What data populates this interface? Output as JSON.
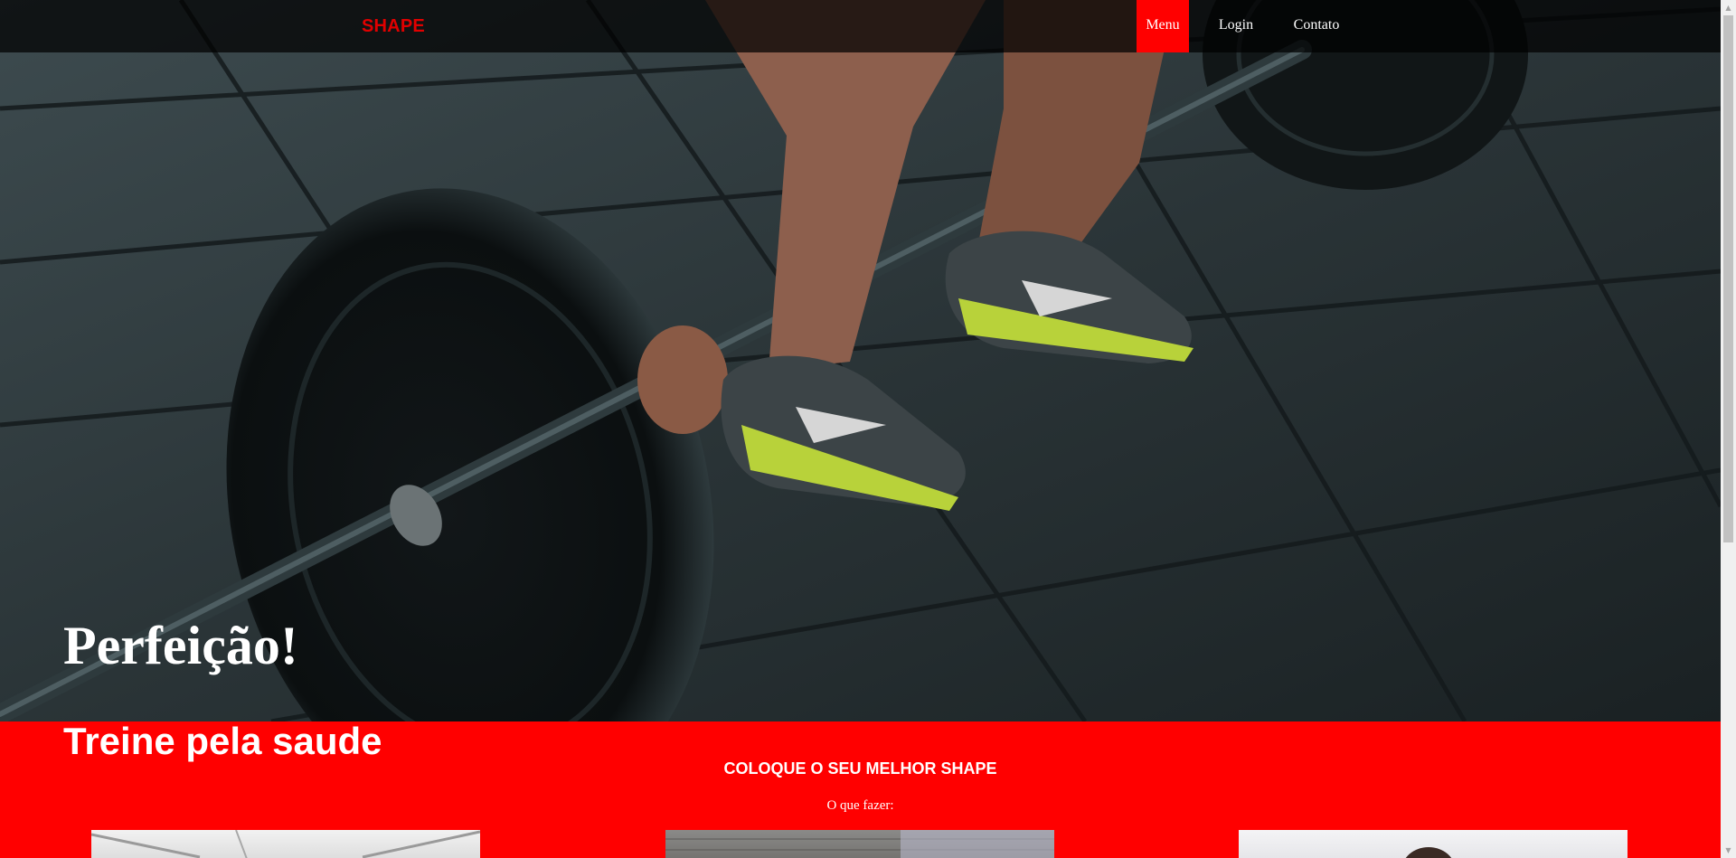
{
  "nav": {
    "brand": "SHAPE",
    "items": [
      {
        "label": "Menu",
        "active": true
      },
      {
        "label": "Login",
        "active": false
      },
      {
        "label": "Contato",
        "active": false
      }
    ]
  },
  "hero": {
    "title": "Perfeição!"
  },
  "section": {
    "title": "Treine pela saude",
    "subtitle": "COLOQUE O SEU MELHOR SHAPE",
    "caption": "O que fazer:"
  },
  "colors": {
    "accent": "#ff0000",
    "brand_text": "#e10000",
    "nav_background": "rgba(0,0,0,0.72)",
    "text_light": "#ffffff"
  }
}
